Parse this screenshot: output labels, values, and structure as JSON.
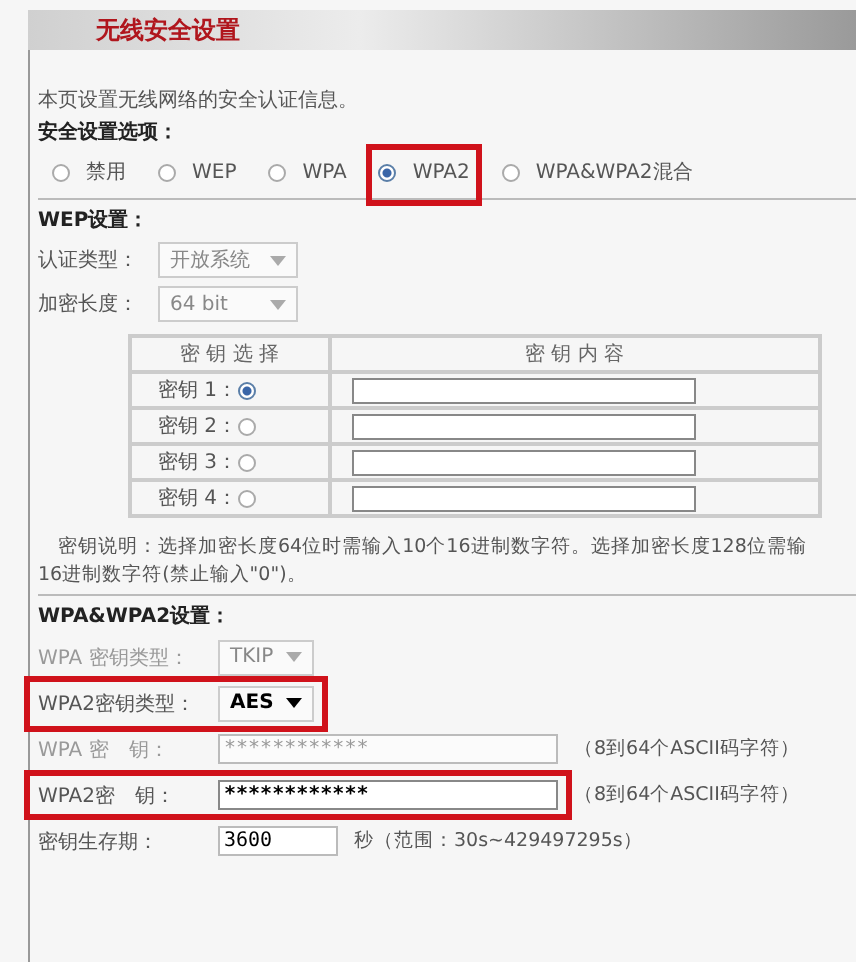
{
  "header": {
    "title": "无线安全设置"
  },
  "intro": "本页设置无线网络的安全认证信息。",
  "options_label": "安全设置选项：",
  "security_options": [
    {
      "label": "禁用",
      "selected": false,
      "highlighted": false
    },
    {
      "label": "WEP",
      "selected": false,
      "highlighted": false
    },
    {
      "label": "WPA",
      "selected": false,
      "highlighted": false
    },
    {
      "label": "WPA2",
      "selected": true,
      "highlighted": true
    },
    {
      "label": "WPA&WPA2混合",
      "selected": false,
      "highlighted": false
    }
  ],
  "wep": {
    "heading": "WEP设置：",
    "fields": [
      {
        "label": "认证类型：",
        "value": "开放系统",
        "disabled": true
      },
      {
        "label": "加密长度：",
        "value": "64 bit",
        "disabled": true
      }
    ],
    "key_table": {
      "columns": [
        "密 钥 选 择",
        "密 钥 内 容"
      ],
      "rows": [
        {
          "label": "密钥 1：",
          "selected": true
        },
        {
          "label": "密钥 2：",
          "selected": false
        },
        {
          "label": "密钥 3：",
          "selected": false
        },
        {
          "label": "密钥 4：",
          "selected": false
        }
      ]
    },
    "note_lines": [
      "密钥说明：选择加密长度64位时需输入10个16进制数字符。选择加密长度128位需输",
      "16进制数字符(禁止输入\"0\")。"
    ]
  },
  "wpa": {
    "heading": "WPA&WPA2设置：",
    "rows": [
      {
        "kind": "select",
        "label": "WPA 密钥类型：",
        "value": "TKIP",
        "disabled": true,
        "highlighted": false
      },
      {
        "kind": "select",
        "label": "WPA2密钥类型：",
        "value": "AES",
        "disabled": false,
        "highlighted": true
      },
      {
        "kind": "input",
        "label": "WPA 密　钥：",
        "value": "************",
        "hint": "（8到64个ASCII码字符）",
        "disabled": true,
        "highlighted": false
      },
      {
        "kind": "input",
        "label": "WPA2密　钥：",
        "value": "************",
        "hint": "（8到64个ASCII码字符）",
        "disabled": false,
        "highlighted": true
      },
      {
        "kind": "short",
        "label": "密钥生存期：",
        "value": "3600",
        "hint": "秒（范围：30s~429497295s）",
        "disabled": false,
        "highlighted": false
      }
    ]
  }
}
